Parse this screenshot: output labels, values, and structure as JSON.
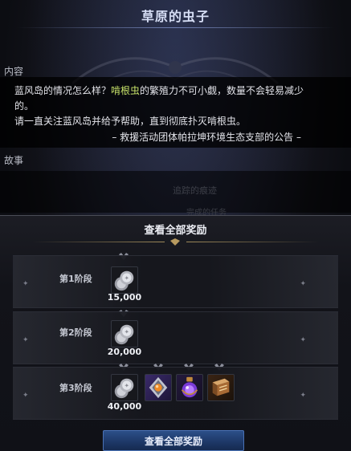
{
  "window": {
    "title": "草原的虫子"
  },
  "content_section": {
    "label": "内容",
    "line1_prefix": "蓝风岛的情况怎么样？",
    "line1_highlight": "啃根虫",
    "line1_suffix": "的繁殖力不可小觑，数量不会轻易减少",
    "line2": "的。",
    "line3": "请一直关注蓝风岛并给予帮助，直到彻底扑灭啃根虫。",
    "signature": "– 救援活动团体帕拉坤环境生态支部的公告 –",
    "highlight_color": "#c8e36a"
  },
  "story_section": {
    "label": "故事",
    "faded_text_1": "追踪的痕迹",
    "faded_text_2": "完成的任务"
  },
  "rewards": {
    "header": "查看全部奖励",
    "stages": [
      {
        "label": "第1阶段",
        "amount": "15,000",
        "items": [
          "silver-coin-stack-icon"
        ]
      },
      {
        "label": "第2阶段",
        "amount": "20,000",
        "items": [
          "silver-coin-stack-icon"
        ]
      },
      {
        "label": "第3阶段",
        "amount": "40,000",
        "items": [
          "silver-coin-stack-icon",
          "orange-gem-crest-icon",
          "purple-potion-flask-icon",
          "brown-skill-book-icon"
        ]
      }
    ],
    "button_label": "查看全部奖励",
    "button_color": "#2c4f88"
  }
}
